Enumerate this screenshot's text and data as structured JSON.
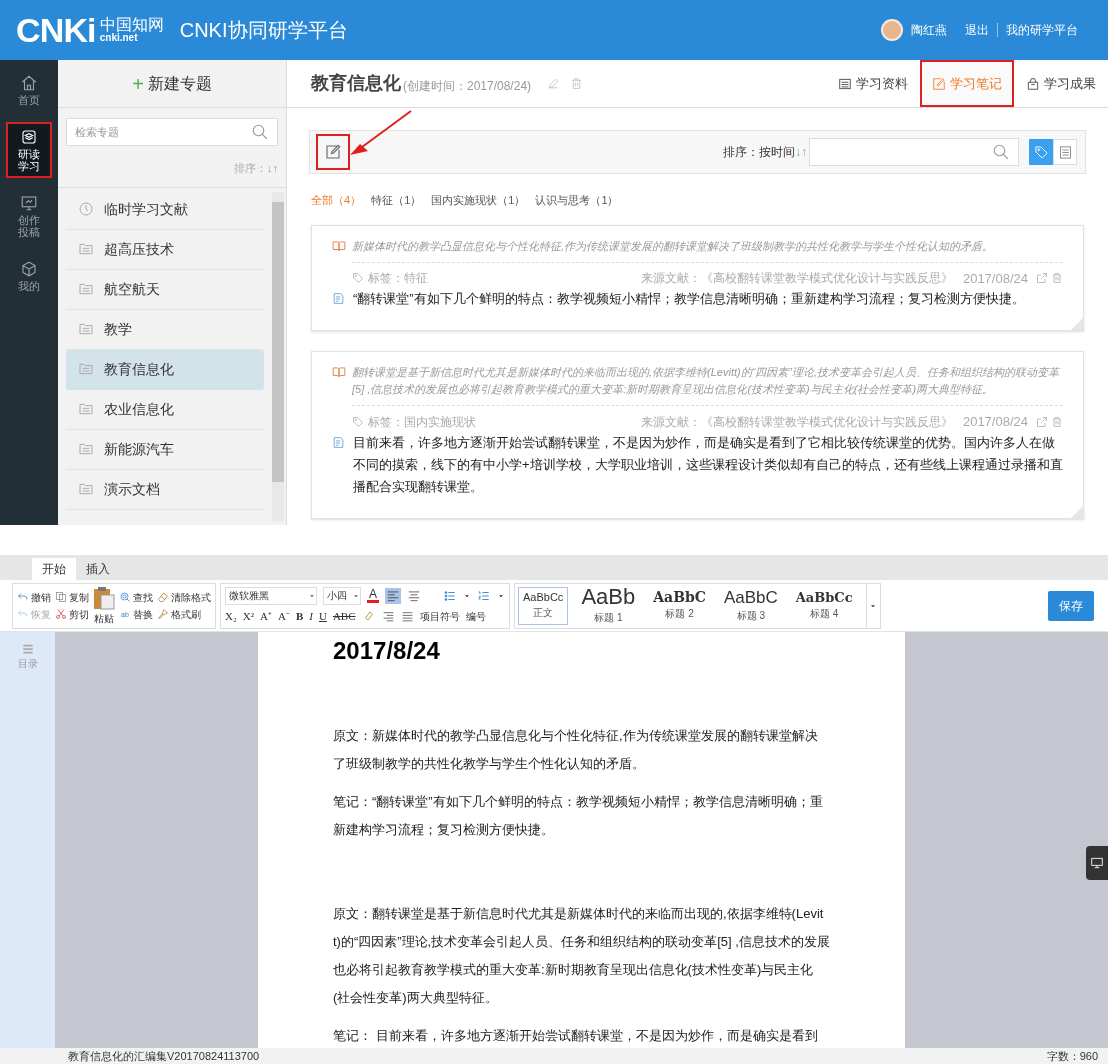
{
  "header": {
    "logo": "CNKi",
    "logo_cn": "中国知网",
    "logo_sub": "cnki.net",
    "title": "CNKI协同研学平台",
    "user": "陶红燕",
    "links": [
      "退出",
      "我的研学平台"
    ]
  },
  "nav": [
    {
      "kind": "home",
      "label": "首页",
      "selected": false,
      "highlighted": false
    },
    {
      "kind": "study",
      "label": "研读学习",
      "selected": true,
      "highlighted": true
    },
    {
      "kind": "create",
      "label": "创作投稿",
      "selected": false,
      "highlighted": false
    },
    {
      "kind": "mine",
      "label": "我的",
      "selected": false,
      "highlighted": false
    }
  ],
  "topics": {
    "new_button_icon": "+",
    "new_button": "新建专题",
    "sort_icon": "↓↑",
    "search": {
      "placeholder": "检索专题"
    },
    "sort": "排序：",
    "items": [
      {
        "kind": "recent",
        "label": "临时学习文献",
        "selected": false
      },
      {
        "kind": "folder",
        "label": "超高压技术",
        "selected": false
      },
      {
        "kind": "folder",
        "label": "航空航天",
        "selected": false
      },
      {
        "kind": "folder",
        "label": "教学",
        "selected": false
      },
      {
        "kind": "folder",
        "label": "教育信息化",
        "selected": true
      },
      {
        "kind": "folder",
        "label": "农业信息化",
        "selected": false
      },
      {
        "kind": "folder",
        "label": "新能源汽车",
        "selected": false
      },
      {
        "kind": "folder",
        "label": "演示文档",
        "selected": false
      }
    ]
  },
  "main": {
    "title": "教育信息化",
    "created": "(创建时间：2017/08/24)",
    "tabs": [
      {
        "label": "学习资料",
        "selected": false,
        "highlighted": false
      },
      {
        "label": "学习笔记",
        "selected": true,
        "highlighted": true
      },
      {
        "label": "学习成果",
        "selected": false,
        "highlighted": false
      }
    ],
    "compose": {
      "highlighted": true
    },
    "sort": "排序：按时间",
    "sort_icon": "↓↑",
    "view": [
      {
        "kind": "tags",
        "selected": true
      },
      {
        "kind": "list",
        "selected": false
      }
    ],
    "filters": [
      {
        "label": "全部（4）",
        "selected": true
      },
      {
        "label": "特征（1）",
        "selected": false
      },
      {
        "label": "国内实施现状（1）",
        "selected": false
      },
      {
        "label": "认识与思考（1）",
        "selected": false
      }
    ],
    "notes": [
      {
        "quote": "新媒体时代的教学凸显信息化与个性化特征,作为传统课堂发展的翻转课堂解决了班级制教学的共性化教学与学生个性化认知的矛盾。",
        "tag": "标签：特征",
        "source": "来源文献：《高校翻转课堂教学模式优化设计与实践反思》",
        "date": "2017/08/24",
        "text": "“翻转课堂”有如下几个鲜明的特点：教学视频短小精悍；教学信息清晰明确；重新建构学习流程；复习检测方便快捷。"
      },
      {
        "quote": "翻转课堂是基于新信息时代尤其是新媒体时代的来临而出现的,依据李维特(Levitt)的“四因素”理论,技术变革会引起人员、任务和组织结构的联动变革[5] ,信息技术的发展也必将引起教育教学模式的重大变革:新时期教育呈现出信息化(技术性变革)与民主化(社会性变革)两大典型特征。",
        "tag": "标签：国内实施现状",
        "source": "来源文献：《高校翻转课堂教学模式优化设计与实践反思》",
        "date": "2017/08/24",
        "text": "目前来看，许多地方逐渐开始尝试翻转课堂，不是因为炒作，而是确实是看到了它相比较传统课堂的优势。国内许多人在做不同的摸索，线下的有中小学+培训学校，大学职业培训，这些课程设计类似却有自己的特点，还有些线上课程通过录播和直播配合实现翻转课堂。"
      }
    ]
  },
  "editor": {
    "tabs": [
      {
        "label": "开始",
        "selected": true
      },
      {
        "label": "插入",
        "selected": false
      }
    ],
    "edit_buttons": [
      {
        "kind": "undo",
        "label": "撤销",
        "disabled": false
      },
      {
        "kind": "copy",
        "label": "复制",
        "disabled": false
      },
      {
        "kind": "redo",
        "label": "恢复",
        "disabled": true
      },
      {
        "kind": "cut",
        "label": "剪切",
        "disabled": false
      }
    ],
    "paste": "粘贴",
    "find_buttons": [
      {
        "kind": "find",
        "label": "查找"
      },
      {
        "kind": "clear",
        "label": "清除格式"
      },
      {
        "kind": "replace",
        "label": "替换"
      },
      {
        "kind": "brush",
        "label": "格式刷"
      }
    ],
    "replace_icon": "ab",
    "font": "微软雅黑",
    "size": "小四",
    "format_buttons": [
      {
        "kind": "sub",
        "label": "X₂"
      },
      {
        "kind": "sup",
        "label": "X²"
      },
      {
        "kind": "grow",
        "label": "A⁺"
      },
      {
        "kind": "shrink",
        "label": "A⁻"
      },
      {
        "kind": "bold",
        "label": "B"
      },
      {
        "kind": "italic",
        "label": "I"
      },
      {
        "kind": "underline",
        "label": "U"
      },
      {
        "kind": "strike",
        "label": "ABC"
      }
    ],
    "font_color": "A",
    "list_labels": [
      "项目符号",
      "编号"
    ],
    "styles": [
      {
        "sample": "AaBbCc",
        "label": "正文",
        "selected": true
      },
      {
        "sample": "AaBb",
        "label": "标题 1",
        "selected": false
      },
      {
        "sample": "AaBbC",
        "label": "标题 2",
        "selected": false
      },
      {
        "sample": "AaBbC",
        "label": "标题 3",
        "selected": false
      },
      {
        "sample": "AaBbCc",
        "label": "标题 4",
        "selected": false
      }
    ],
    "save": "保存",
    "toc": "目录",
    "document": {
      "heading": "2017/8/24",
      "paragraphs": [
        {
          "kind": "quote",
          "text": "原文：新媒体时代的教学凸显信息化与个性化特征,作为传统课堂发展的翻转课堂解决了班级制教学的共性化教学与学生个性化认知的矛盾。"
        },
        {
          "kind": "note",
          "text": "笔记：“翻转课堂”有如下几个鲜明的特点：教学视频短小精悍；教学信息清晰明确；重新建构学习流程；复习检测方便快捷。"
        },
        {
          "kind": "quote",
          "text": "原文：翻转课堂是基于新信息时代尤其是新媒体时代的来临而出现的,依据李维特(Levitt)的“四因素”理论,技术变革会引起人员、任务和组织结构的联动变革[5] ,信息技术的发展也必将引起教育教学模式的重大变革:新时期教育呈现出信息化(技术性变革)与民主化(社会性变革)两大典型特征。"
        },
        {
          "kind": "note",
          "text": "笔记： 目前来看，许多地方逐渐开始尝试翻转课堂，不是因为炒作，而是确实是看到"
        }
      ]
    },
    "status": {
      "filename": "教育信息化的汇编集V20170824113700",
      "word_count": "字数：960"
    }
  }
}
